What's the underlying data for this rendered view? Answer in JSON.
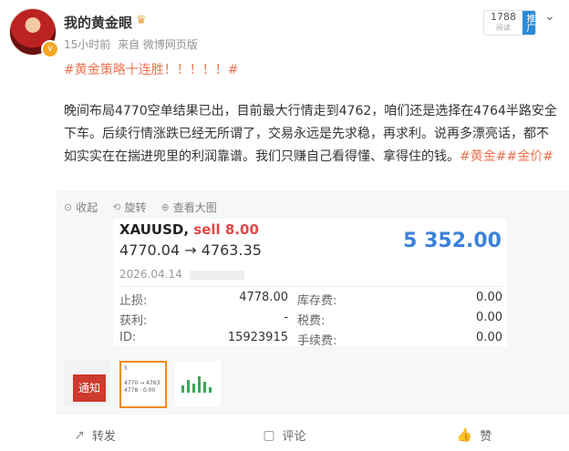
{
  "header": {
    "nickname": "我的黄金眼",
    "time": "15小时前",
    "source": "来自 微博网页版",
    "count": "1788",
    "count_sub": "阅读",
    "promo": "推广"
  },
  "post": {
    "hashtag_title": "#黄金策略十连胜！！！！！#",
    "body": "晚间布局4770空单结果已出，目前最大行情走到4762，咱们还是选择在4764半路安全下车。后续行情涨跌已经无所谓了，交易永远是先求稳，再求利。说再多漂亮话，都不如实实在在揣进兜里的利润靠谱。我们只赚自己看得懂、拿得住的钱。",
    "tags": [
      "#黄金#",
      "#金价#"
    ]
  },
  "quote_actions": {
    "collapse": "收起",
    "rotate": "旋转",
    "view_large": "查看大图"
  },
  "trade": {
    "symbol": "XAUUSD,",
    "side": "sell 8.00",
    "open_price": "4770.04",
    "arrow": "→",
    "close_price": "4763.35",
    "profit": "5 352.00",
    "date": "2026.04.14",
    "rows": [
      {
        "label": "止损:",
        "value": "4778.00",
        "label2": "库存费:",
        "value2": "0.00"
      },
      {
        "label": "获利:",
        "value": "-",
        "label2": "税费:",
        "value2": "0.00"
      },
      {
        "label": "ID:",
        "value": "15923915",
        "label2": "手续费:",
        "value2": "0.00"
      }
    ]
  },
  "thumbs": {
    "notice": "通知"
  },
  "actions": {
    "repost": "转发",
    "comment": "评论",
    "like": "赞"
  }
}
